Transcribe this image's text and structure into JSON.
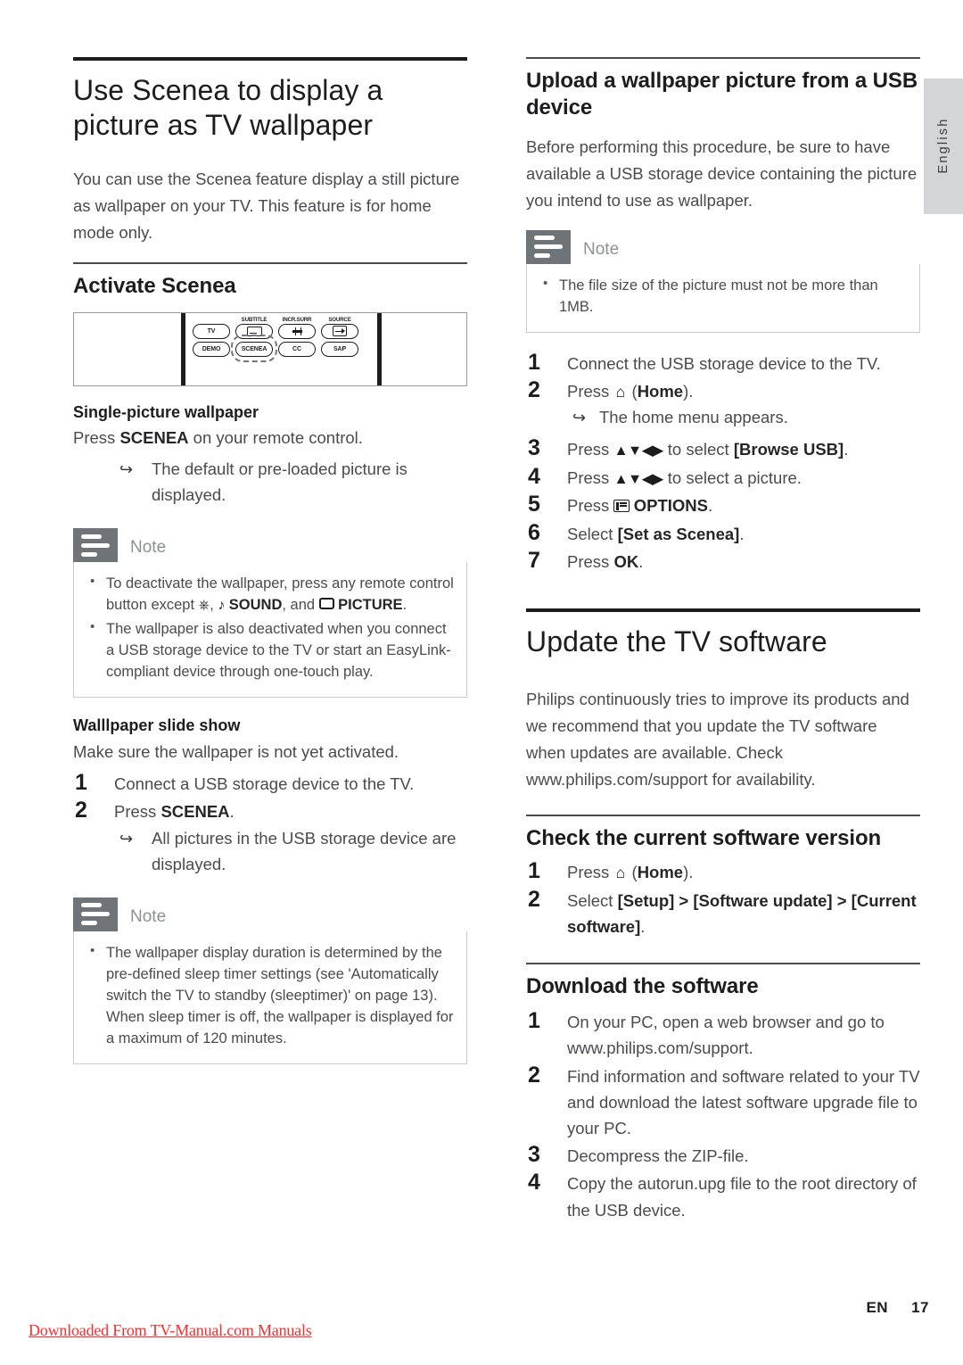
{
  "language_tab": "English",
  "left_column": {
    "chapter_title": "Use Scenea to display a picture as TV wallpaper",
    "intro": "You can use the Scenea feature display a still picture as wallpaper on your TV. This feature is for home mode only.",
    "activate_section": {
      "heading": "Activate Scenea",
      "remote_figure": {
        "row1": [
          {
            "caption": "",
            "label": "TV",
            "icon": "none"
          },
          {
            "caption": "SUBTITLE",
            "label": "",
            "icon": "subtitle-icon"
          },
          {
            "caption": "INCR.SURR",
            "label": "",
            "icon": "surround-icon"
          },
          {
            "caption": "SOURCE",
            "label": "",
            "icon": "source-icon"
          }
        ],
        "row2": [
          {
            "caption": "",
            "label": "DEMO",
            "icon": "none",
            "highlight": false
          },
          {
            "caption": "",
            "label": "SCENEA",
            "icon": "none",
            "highlight": true
          },
          {
            "caption": "",
            "label": "CC",
            "icon": "none",
            "highlight": false
          },
          {
            "caption": "",
            "label": "SAP",
            "icon": "none",
            "highlight": false
          }
        ]
      },
      "single_picture": {
        "heading": "Single-picture wallpaper",
        "instruction_pre": "Press ",
        "instruction_bold": "SCENEA",
        "instruction_post": " on your remote control.",
        "result": "The default or pre-loaded picture is displayed."
      },
      "note1": {
        "label": "Note",
        "bullets": [
          {
            "part1": "To deactivate the wallpaper, press any remote control button except ",
            "icon1": "power-icon",
            "part2": ", ",
            "icon2": "music-note-icon",
            "bold1": "SOUND",
            "part3": ", and ",
            "icon3": "picture-rect-icon",
            "bold2": "PICTURE",
            "part4": "."
          },
          {
            "text": "The wallpaper is also deactivated when you connect a USB storage device to the TV or start an EasyLink-compliant device through one-touch play."
          }
        ]
      },
      "slide_show": {
        "heading": "Walllpaper slide show",
        "lead": "Make sure the wallpaper is not yet activated.",
        "steps": [
          {
            "num": "1",
            "text": "Connect a USB storage device to the TV."
          },
          {
            "num": "2",
            "pre": "Press ",
            "bold": "SCENEA",
            "post": "."
          }
        ],
        "result": "All pictures in the USB storage device are displayed."
      },
      "note2": {
        "label": "Note",
        "bullets": [
          "The wallpaper display duration is determined by the pre-defined sleep timer settings (see 'Automatically switch the TV to standby (sleeptimer)' on page 13). When sleep timer is off, the wallpaper is displayed for a maximum of 120 minutes."
        ]
      }
    }
  },
  "right_column": {
    "upload_section": {
      "heading": "Upload a wallpaper picture from a USB device",
      "intro": "Before performing this procedure, be sure to have available a USB storage device containing the picture you intend to use as wallpaper.",
      "note": {
        "label": "Note",
        "bullets": [
          "The file size of the picture must not be more than 1MB."
        ]
      },
      "steps": [
        {
          "num": "1",
          "text": "Connect the USB storage device to the TV."
        },
        {
          "num": "2",
          "pre": "Press ",
          "icon": "home-icon",
          "mid": " (",
          "bold": "Home",
          "post": ").",
          "result": "The home menu appears."
        },
        {
          "num": "3",
          "pre": "Press ",
          "arrows": "▲▼◀▶",
          "mid": " to select ",
          "bold": "[Browse USB]",
          "post": "."
        },
        {
          "num": "4",
          "pre": "Press ",
          "arrows": "▲▼◀▶",
          "mid": " to select a picture.",
          "bold": "",
          "post": ""
        },
        {
          "num": "5",
          "pre": "Press ",
          "icon": "options-icon",
          "mid": " ",
          "bold": "OPTIONS",
          "post": "."
        },
        {
          "num": "6",
          "pre": "Select ",
          "bold": "[Set as Scenea]",
          "post": "."
        },
        {
          "num": "7",
          "pre": "Press ",
          "bold": "OK",
          "post": "."
        }
      ]
    },
    "update_section": {
      "chapter_title": "Update the TV software",
      "intro": "Philips continuously tries to improve its products and we recommend that you update the TV software when updates are available. Check www.philips.com/support for availability.",
      "check_version": {
        "heading": "Check the current software version",
        "steps": [
          {
            "num": "1",
            "pre": "Press ",
            "icon": "home-icon",
            "mid": " (",
            "bold": "Home",
            "post": ")."
          },
          {
            "num": "2",
            "pre": "Select ",
            "bold": "[Setup] > [Software update] > [Current software]",
            "post": "."
          }
        ]
      },
      "download": {
        "heading": "Download the software",
        "steps": [
          {
            "num": "1",
            "text": "On your PC, open a web browser and go to www.philips.com/support."
          },
          {
            "num": "2",
            "text": "Find information and software related to your TV and download the latest software upgrade file to your PC."
          },
          {
            "num": "3",
            "text": "Decompress the ZIP-file."
          },
          {
            "num": "4",
            "text": "Copy the autorun.upg file to the root directory of the USB device."
          }
        ]
      }
    }
  },
  "footer": {
    "lang_code": "EN",
    "page_number": "17",
    "watermark": "Downloaded From TV-Manual.com Manuals"
  }
}
